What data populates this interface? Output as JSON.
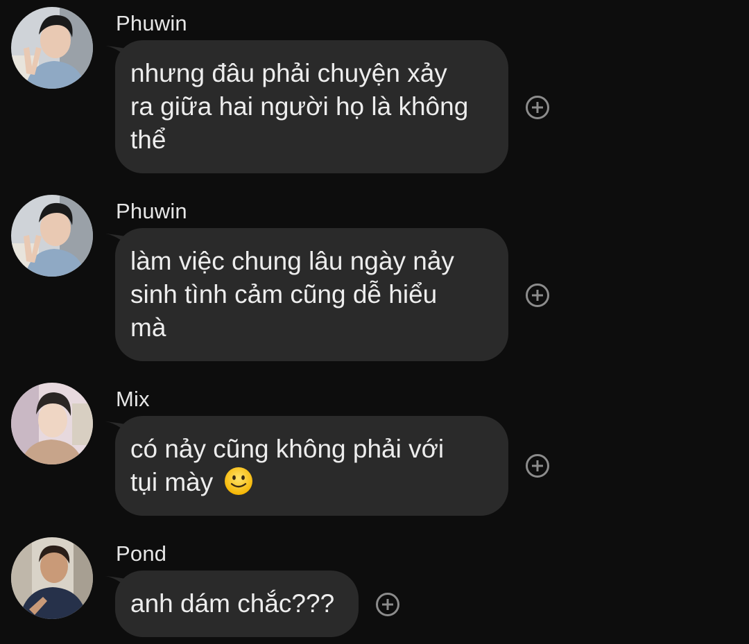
{
  "messages": [
    {
      "sender": "Phuwin",
      "avatar": "avatar-phuwin-icon",
      "lines": [
        "nhưng đâu phải chuyện xảy",
        "ra giữa hai người họ là không",
        "thể"
      ]
    },
    {
      "sender": "Phuwin",
      "avatar": "avatar-phuwin-icon",
      "lines": [
        "làm việc chung lâu ngày nảy",
        "sinh tình cảm cũng dễ hiểu",
        "mà"
      ]
    },
    {
      "sender": "Mix",
      "avatar": "avatar-mix-icon",
      "lines": [
        "có nảy cũng không phải với",
        "tụi mày"
      ],
      "emoji": "slightly-smiling-face-icon"
    },
    {
      "sender": "Pond",
      "avatar": "avatar-pond-icon",
      "lines": [
        "anh dám chắc???"
      ]
    }
  ],
  "colors": {
    "background": "#0d0d0d",
    "bubble": "#2a2a2a",
    "text": "#ededed",
    "react_icon": "#8c8c8c"
  },
  "icons": {
    "add_reaction": "add-reaction-icon"
  }
}
